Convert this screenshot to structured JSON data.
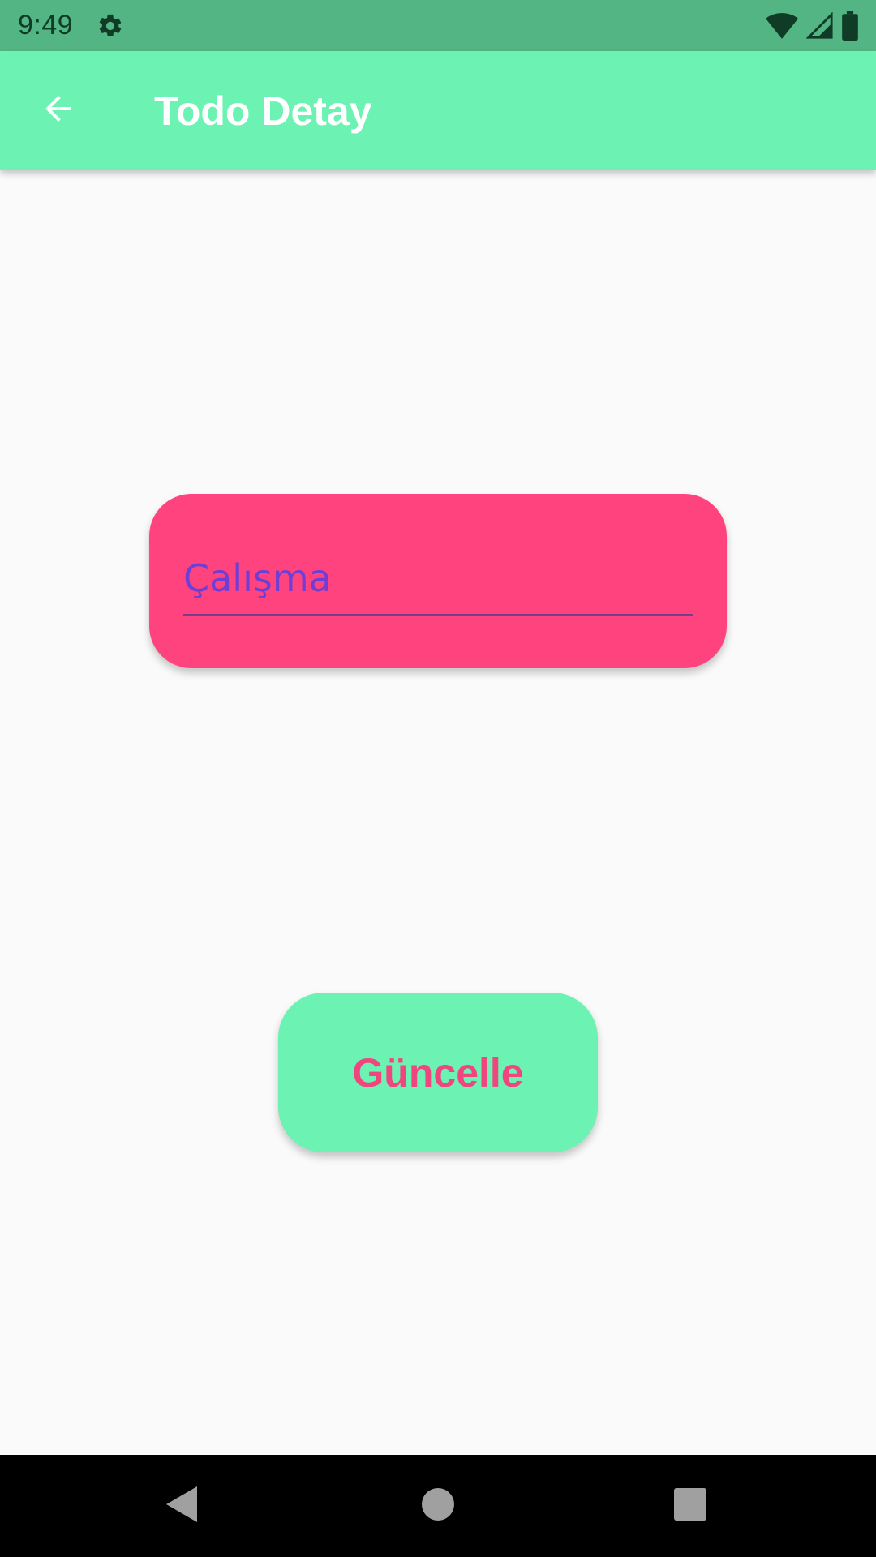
{
  "status_bar": {
    "time": "9:49",
    "icons": [
      "settings-gear-icon",
      "wifi-icon",
      "cell-signal-icon",
      "battery-icon"
    ]
  },
  "app_bar": {
    "title": "Todo Detay",
    "back_icon": "arrow-back-icon"
  },
  "form": {
    "todo_value": "Çalışma"
  },
  "actions": {
    "update_label": "Güncelle"
  },
  "nav_bar": {
    "icons": [
      "back-triangle-icon",
      "home-circle-icon",
      "recents-square-icon"
    ]
  },
  "colors": {
    "status_bar": "#53B583",
    "app_bar": "#6CF2B2",
    "card": "#FF437E",
    "input_text": "#6E3FD6",
    "button": "#6CF2B2",
    "button_text": "#F0467F",
    "background": "#FAFAFA"
  }
}
